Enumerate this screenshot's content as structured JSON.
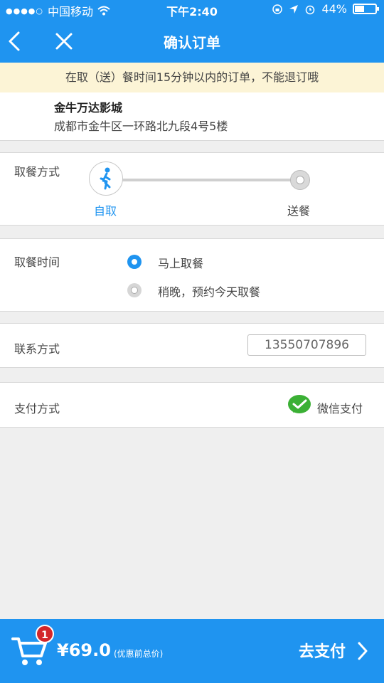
{
  "status_bar": {
    "signal": "●●●●○",
    "carrier": "中国移动",
    "wifi_icon": "wifi-icon",
    "time": "下午2:40",
    "battery": "44%",
    "battery_level": 0.44
  },
  "nav": {
    "back_icon": "chevron-left-icon",
    "close_icon": "close-icon",
    "title": "确认订单"
  },
  "notice": "在取（送）餐时间15分钟以内的订单，不能退订哦",
  "store": {
    "name": "金牛万达影城",
    "address": "成都市金牛区一环路北九段4号5楼"
  },
  "pickup": {
    "label": "取餐方式",
    "options": [
      "自取",
      "送餐"
    ],
    "selected": "自取"
  },
  "pickup_time": {
    "label": "取餐时间",
    "options": [
      "马上取餐",
      "稍晚，预约今天取餐"
    ],
    "selected": "马上取餐"
  },
  "contact": {
    "label": "联系方式",
    "phone": "13550707896"
  },
  "payment": {
    "label": "支付方式",
    "method": "微信支付"
  },
  "bottom": {
    "cart_count": "1",
    "price": "¥69.0",
    "price_note": "(优惠前总价)",
    "pay_button": "去支付"
  },
  "colors": {
    "primary": "#1f94f0",
    "notice_bg": "#fcf4d6",
    "badge": "#d3262b",
    "wechat": "#3bb035"
  }
}
